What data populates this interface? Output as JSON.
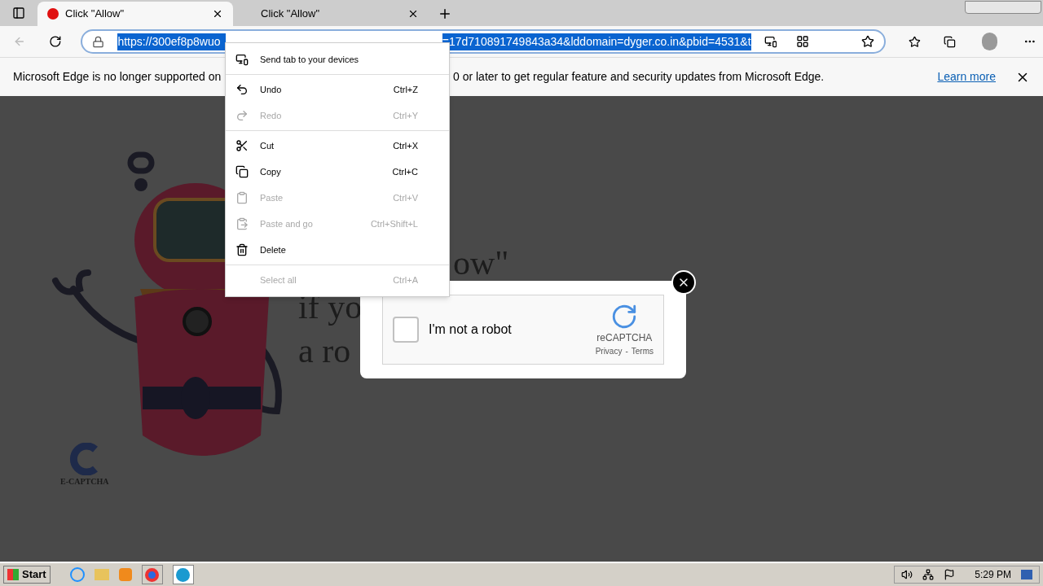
{
  "tabs": [
    {
      "title": "Click \"Allow\"",
      "selected": true
    },
    {
      "title": "Click \"Allow\"",
      "selected": false
    }
  ],
  "address_bar": {
    "url_start": "https://300ef8p8wuo",
    "url_end": "=17d710891749843a34&lddomain=dyger.co.in&pbid=4531&t",
    "selected": true
  },
  "info_bar": {
    "text_start": "Microsoft Edge is no longer supported on",
    "text_end": "0 or later to get regular feature and security updates from Microsoft Edge.",
    "link": "Learn more"
  },
  "context_menu": [
    {
      "label": "Send tab to your devices",
      "disabled": false,
      "kind": "devices",
      "divider_after": true
    },
    {
      "label": "Undo",
      "shortcut": "Ctrl+Z",
      "disabled": false,
      "kind": "undo",
      "divider_after": false
    },
    {
      "label": "Redo",
      "shortcut": "Ctrl+Y",
      "disabled": true,
      "kind": "redo",
      "divider_after": true
    },
    {
      "label": "Cut",
      "shortcut": "Ctrl+X",
      "disabled": false,
      "kind": "cut",
      "divider_after": false
    },
    {
      "label": "Copy",
      "shortcut": "Ctrl+C",
      "disabled": false,
      "kind": "copy",
      "divider_after": false
    },
    {
      "label": "Paste",
      "shortcut": "Ctrl+V",
      "disabled": true,
      "kind": "paste",
      "divider_after": false
    },
    {
      "label": "Paste and go",
      "shortcut": "Ctrl+Shift+L",
      "disabled": true,
      "kind": "pastego",
      "divider_after": false
    },
    {
      "label": "Delete",
      "disabled": false,
      "kind": "delete",
      "divider_after": true
    },
    {
      "label": "Select all",
      "shortcut": "Ctrl+A",
      "disabled": true,
      "kind": "none",
      "divider_after": false
    }
  ],
  "page": {
    "headline_fragments": [
      "ow\"",
      "if yo",
      "a ro"
    ],
    "logo_text": "E-CAPTCHA"
  },
  "captcha": {
    "label": "I'm not a robot",
    "checked": false,
    "brand": "reCAPTCHA",
    "privacy": "Privacy",
    "separator": "-",
    "terms": "Terms"
  },
  "taskbar": {
    "start": "Start",
    "time": "5:29 PM"
  }
}
